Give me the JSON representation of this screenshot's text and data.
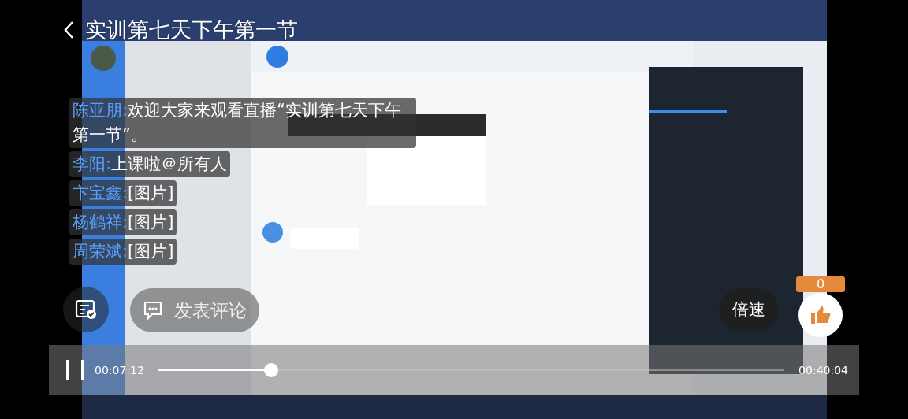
{
  "title": "实训第七天下午第一节",
  "comments": [
    {
      "name": "陈亚朋:",
      "text": "欢迎大家来观看直播“实训第七天下午第一节”。"
    },
    {
      "name": "李阳:",
      "text": "上课啦＠所有人"
    },
    {
      "name": "卞宝鑫:",
      "text": "[图片]"
    },
    {
      "name": "杨鹤祥:",
      "text": "[图片]"
    },
    {
      "name": "周荣斌:",
      "text": "[图片]"
    }
  ],
  "comment_button": "发表评论",
  "speed_button": "倍速",
  "likes": "0",
  "player": {
    "elapsed": "00:07:12",
    "duration": "00:40:04",
    "level": 0.18
  }
}
